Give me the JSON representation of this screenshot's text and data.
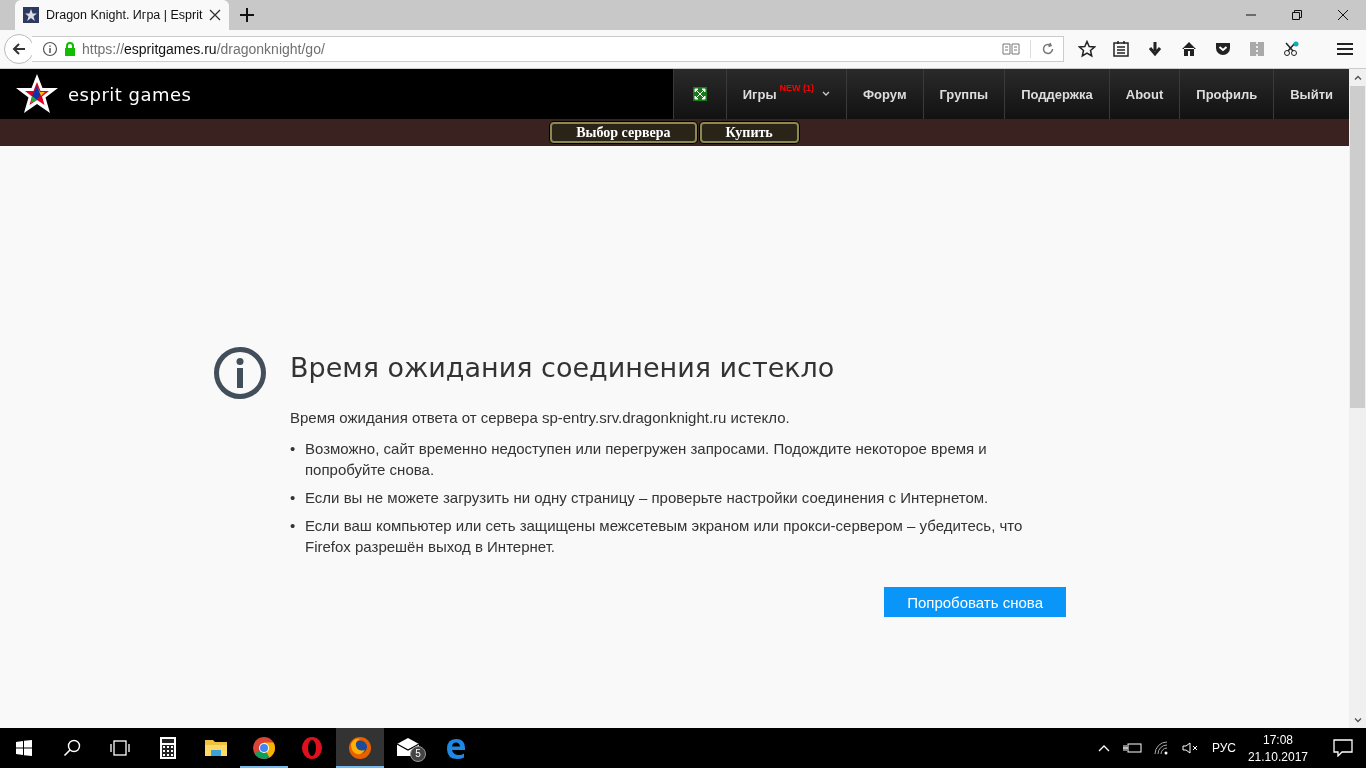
{
  "browser": {
    "tabs": [
      {
        "title": "Dragon Knight. Игра | Esprit",
        "selected": true
      }
    ],
    "url": {
      "scheme": "https://",
      "host": "espritgames.ru",
      "path": "/dragonknight/go/"
    }
  },
  "site": {
    "logo": "esprit games",
    "nav": [
      {
        "kind": "icon"
      },
      {
        "kind": "dropdown",
        "label": "Игры",
        "badge": "NEW (1)"
      },
      {
        "kind": "link",
        "label": "Форум"
      },
      {
        "kind": "link",
        "label": "Группы"
      },
      {
        "kind": "link",
        "label": "Поддержка"
      },
      {
        "kind": "link",
        "label": "About"
      },
      {
        "kind": "link",
        "label": "Профиль"
      },
      {
        "kind": "link",
        "label": "Выйти"
      }
    ],
    "subnav": [
      "Выбор сервера",
      "Купить"
    ]
  },
  "error": {
    "title": "Время ожидания соединения истекло",
    "description": "Время ожидания ответа от сервера sp-entry.srv.dragonknight.ru истекло.",
    "bullets": [
      {
        "marker": "•",
        "text": "Возможно, сайт временно недоступен или перегружен запросами. Подождите некоторое время и попробуйте снова."
      },
      {
        "marker": "•",
        "text": "Если вы не можете загрузить ни одну страницу – проверьте настройки соединения с Интернетом."
      },
      {
        "marker": "•",
        "text": "Если ваш компьютер или сеть защищены межсетевым экраном или прокси-сервером – убедитесь, что Firefox разрешён выход в Интернет."
      }
    ],
    "button": "Попробовать снова"
  },
  "taskbar": {
    "apps": [
      {
        "kind": "calculator",
        "running": false,
        "active": false
      },
      {
        "kind": "folder",
        "running": false,
        "active": false
      },
      {
        "kind": "chrome",
        "running": true,
        "active": false
      },
      {
        "kind": "opera",
        "running": false,
        "active": false
      },
      {
        "kind": "firefox",
        "running": true,
        "active": true
      },
      {
        "kind": "mail",
        "running": false,
        "active": false,
        "badge": "5"
      },
      {
        "kind": "edge",
        "running": false,
        "active": false
      }
    ],
    "language": "РУС",
    "time": "17:08",
    "date": "21.10.2017"
  }
}
